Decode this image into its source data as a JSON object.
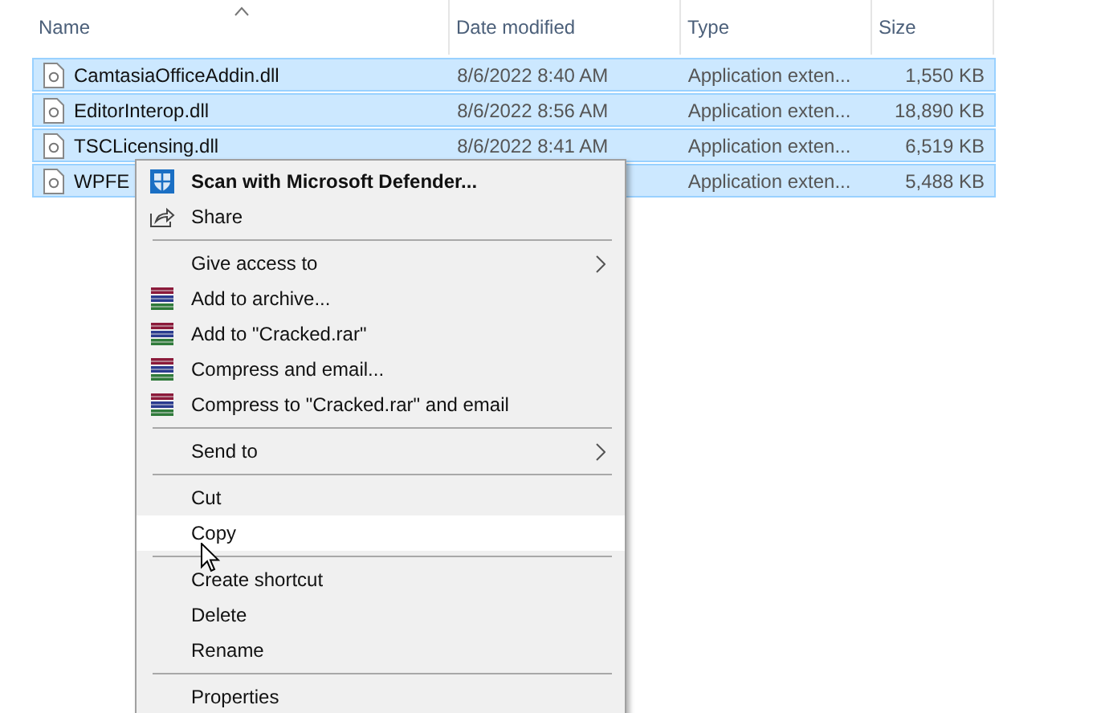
{
  "file_list": {
    "columns": [
      {
        "label": "Name",
        "sorted": true
      },
      {
        "label": "Date modified",
        "sorted": false
      },
      {
        "label": "Type",
        "sorted": false
      },
      {
        "label": "Size",
        "sorted": false
      }
    ],
    "rows": [
      {
        "name": "CamtasiaOfficeAddin.dll",
        "date": "8/6/2022 8:40 AM",
        "type": "Application exten...",
        "size": "1,550 KB",
        "selected": true
      },
      {
        "name": "EditorInterop.dll",
        "date": "8/6/2022 8:56 AM",
        "type": "Application exten...",
        "size": "18,890 KB",
        "selected": true
      },
      {
        "name": "TSCLicensing.dll",
        "date": "8/6/2022 8:41 AM",
        "type": "Application exten...",
        "size": "6,519 KB",
        "selected": true
      },
      {
        "name": "WPFE",
        "type": "Application exten...",
        "size": "5,488 KB",
        "selected": true
      }
    ]
  },
  "context_menu": {
    "items": [
      {
        "kind": "defender",
        "label": "Scan with Microsoft Defender...",
        "selected": false
      },
      {
        "kind": "share",
        "label": "Share",
        "selected": false
      },
      {
        "kind": "separator"
      },
      {
        "kind": "submenu",
        "label": "Give access to",
        "selected": false
      },
      {
        "kind": "archive",
        "label": "Add to archive...",
        "selected": false
      },
      {
        "kind": "archive",
        "label": "Add to \"Cracked.rar\"",
        "selected": false
      },
      {
        "kind": "archive",
        "label": "Compress and email...",
        "selected": false
      },
      {
        "kind": "archive",
        "label": "Compress to \"Cracked.rar\" and email",
        "selected": false
      },
      {
        "kind": "separator"
      },
      {
        "kind": "submenu",
        "label": "Send to",
        "selected": false
      },
      {
        "kind": "separator"
      },
      {
        "kind": "plain",
        "label": "Cut",
        "selected": false
      },
      {
        "kind": "plain",
        "label": "Copy",
        "selected": true
      },
      {
        "kind": "separator"
      },
      {
        "kind": "plain",
        "label": "Create shortcut",
        "selected": false
      },
      {
        "kind": "plain",
        "label": "Delete",
        "selected": false
      },
      {
        "kind": "plain",
        "label": "Rename",
        "selected": false
      },
      {
        "kind": "separator"
      },
      {
        "kind": "plain",
        "label": "Properties",
        "selected": false
      }
    ]
  }
}
